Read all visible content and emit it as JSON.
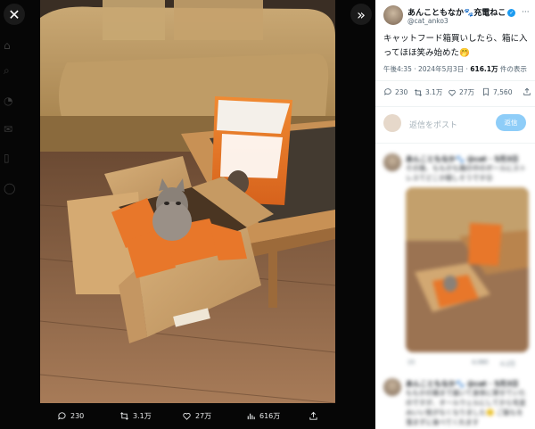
{
  "viewer": {
    "close_icon": "close-icon",
    "expand_icon": "chevron-right-icon",
    "bar": {
      "replies": "230",
      "reposts": "3.1万",
      "likes": "27万",
      "views": "616万"
    }
  },
  "tweet": {
    "author_name": "あんこともなか🐾充電ねこ",
    "author_handle": "@cat_anko3",
    "text": "キャットフード箱買いしたら、箱に入ってほほ笑み始めた🤭",
    "time": "午後4:35 · 2024年5月3日 · ",
    "views_count": "616.1万",
    "views_label": " 件の表示",
    "stats": {
      "replies": "230",
      "reposts": "3.1万",
      "likes": "27万",
      "bookmarks": "7,560"
    }
  },
  "composer": {
    "placeholder": "返信をポスト",
    "button": "返信"
  },
  "replies": [
    {
      "name": "あんこともなか🐾 @cat · 5月3日",
      "text": "その後、ももかも箱の中のボールにストレスてどこか嬉しそうです😊"
    },
    {
      "name": "あんこともなか🐾 @cat · 5月3日",
      "text": "ももかの箱まで届いて身体に寄せていたのですが、オールウェルにしてから毛並みいい気がなくなりました🙂 ご飯もを落まずに食べてくれます"
    }
  ],
  "reply_stats": {
    "comments": "15",
    "likes": "4,080",
    "views": "4.2万"
  },
  "colors": {
    "accent": "#1d9bf0",
    "viewer_bg": "#060606",
    "bag_orange": "#e8772a"
  }
}
